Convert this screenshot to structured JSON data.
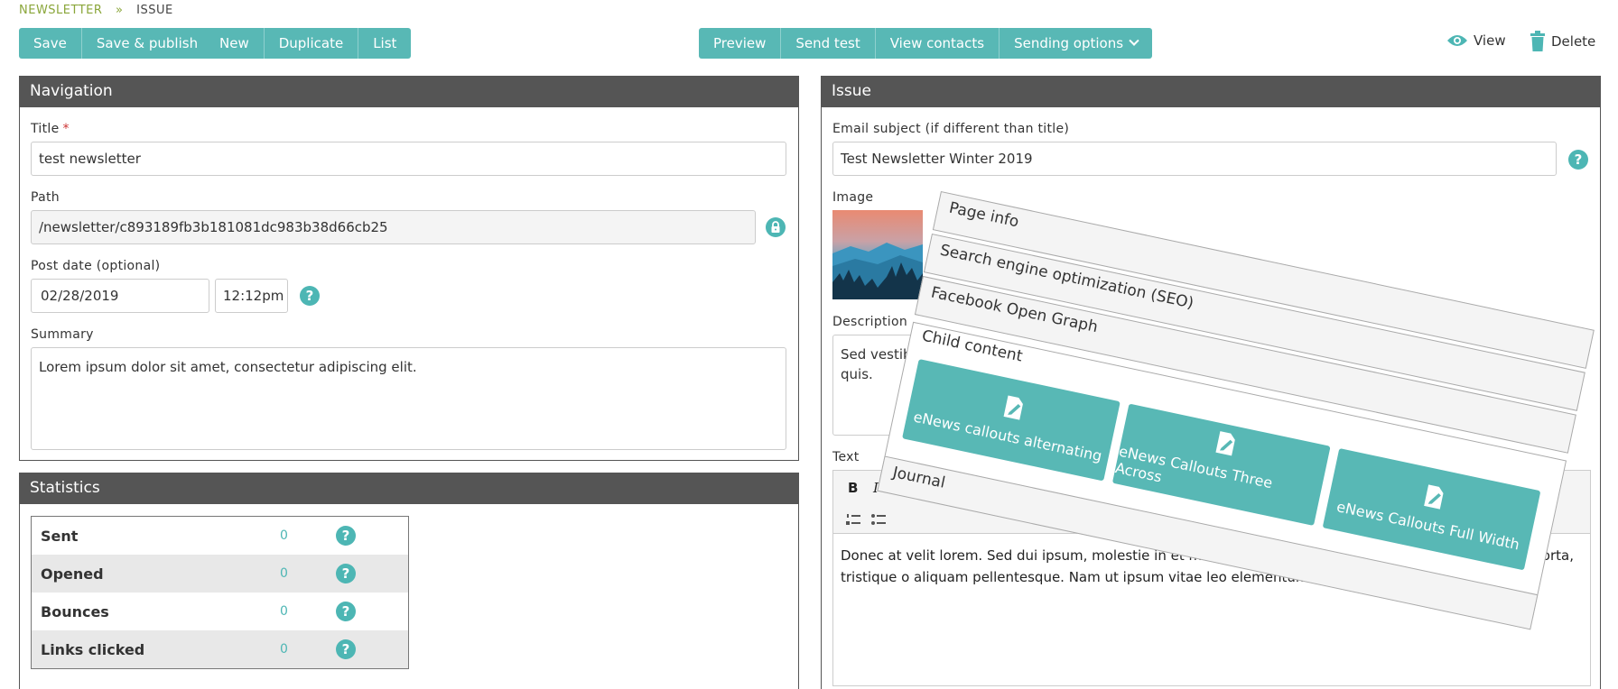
{
  "breadcrumb": {
    "parent": "Newsletter",
    "separator": "»",
    "current": "Issue"
  },
  "toolbar": {
    "save": "Save",
    "save_publish": "Save & publish",
    "new": "New",
    "duplicate": "Duplicate",
    "list": "List",
    "preview": "Preview",
    "send_test": "Send test",
    "view_contacts": "View contacts",
    "sending_options": "Sending options",
    "view": "View",
    "delete": "Delete"
  },
  "navigation": {
    "header": "Navigation",
    "title_label": "Title",
    "title_required": "*",
    "title_value": "test newsletter",
    "path_label": "Path",
    "path_value": "/newsletter/c893189fb3b181081dc983b38d66cb25",
    "post_date_label": "Post date (optional)",
    "post_date_value": "02/28/2019",
    "post_time_value": "12:12pm",
    "summary_label": "Summary",
    "summary_value": "Lorem ipsum dolor sit amet, consectetur adipiscing elit."
  },
  "statistics": {
    "header": "Statistics",
    "rows": [
      {
        "label": "Sent",
        "value": "0"
      },
      {
        "label": "Opened",
        "value": "0"
      },
      {
        "label": "Bounces",
        "value": "0"
      },
      {
        "label": "Links clicked",
        "value": "0"
      }
    ]
  },
  "issue": {
    "header": "Issue",
    "email_subject_label": "Email subject (if different than title)",
    "email_subject_value": "Test Newsletter Winter 2019",
    "image_label": "Image",
    "description_label": "Description",
    "description_value": "Sed vestib quis.",
    "text_label": "Text",
    "text_value": "Donec at velit lorem. Sed dui ipsum, molestie in et mauris, vel luctus sapien semper at. Donec eu est porta, tristique o aliquam pellentesque. Nam ut ipsum vitae leo elementum bibendum et sit amet massa."
  },
  "overlay": {
    "tabs": [
      "Page info",
      "Search engine optimization (SEO)",
      "Facebook Open Graph"
    ],
    "child_content_label": "Child content",
    "cards": [
      "eNews callouts alternating",
      "eNews Callouts Three Across",
      "eNews Callouts Full Width"
    ],
    "journal_label": "Journal"
  },
  "icons": {
    "view": "eye-icon",
    "delete": "trash-icon",
    "lock": "lock-icon",
    "help": "question-icon",
    "card": "document-edit-icon"
  },
  "colors": {
    "accent": "#58b8b5",
    "header": "#555555",
    "breadcrumb": "#8aa63a"
  }
}
